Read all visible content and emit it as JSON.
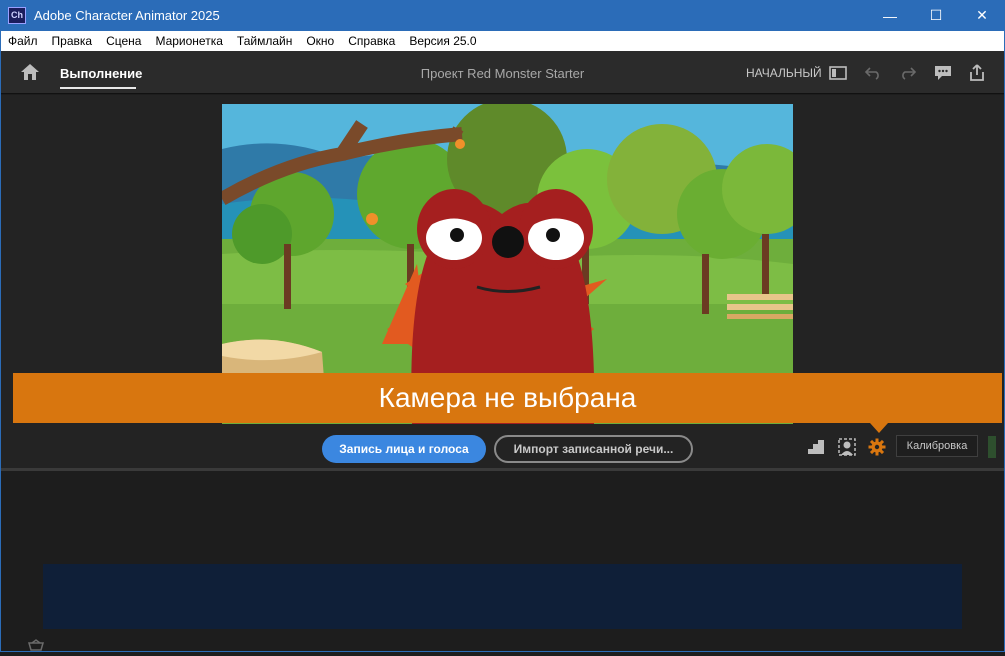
{
  "window": {
    "app_icon_text": "Ch",
    "title": "Adobe Character Animator 2025",
    "minimize": "—",
    "maximize": "☐",
    "close": "✕"
  },
  "menu": [
    "Файл",
    "Правка",
    "Сцена",
    "Марионетка",
    "Таймлайн",
    "Окно",
    "Справка",
    "Версия 25.0"
  ],
  "topbar": {
    "tab_label": "Выполнение",
    "project_title": "Проект Red Monster Starter",
    "workspace_label": "НАЧАЛЬНЫЙ",
    "icons": [
      "home-icon",
      "panel-toggle-icon",
      "undo-icon",
      "redo-icon",
      "comment-icon",
      "share-icon"
    ]
  },
  "scene": {
    "banner_text": "Камера не выбрана"
  },
  "controls": {
    "record_label": "Запись лица и голоса",
    "import_label": "Импорт записанной речи...",
    "calibrate_label": "Калибровка",
    "icons": [
      "steps-icon",
      "face-tracking-icon",
      "gear-icon"
    ],
    "accent_color": "#d8760f",
    "record_color": "#3b87e0"
  }
}
